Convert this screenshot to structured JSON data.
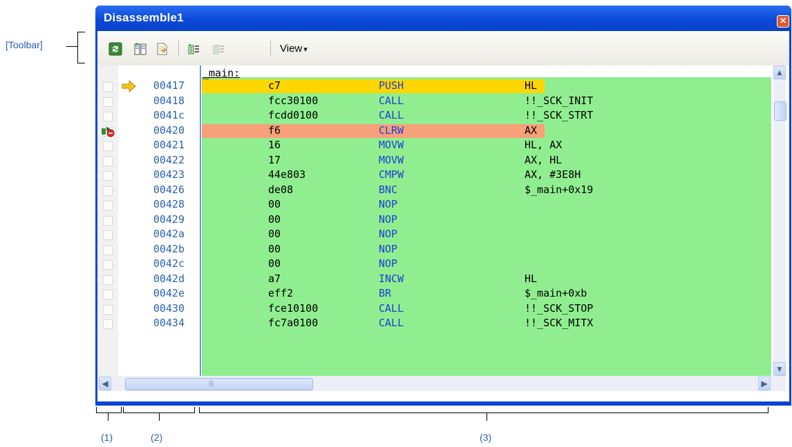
{
  "window": {
    "title": "Disassemble1",
    "close_glyph": "✕"
  },
  "toolbar": {
    "icons": [
      "refresh-icon",
      "show-code-icon",
      "jump-to-source-icon",
      "previous-symbol-icon",
      "next-symbol-icon"
    ],
    "view_label": "View",
    "view_arrow": "▾"
  },
  "annotations": {
    "toolbar": "[Toolbar]",
    "area1": "(1)",
    "area2": "(2)",
    "area3": "(3)"
  },
  "listing": {
    "label": "_main:",
    "rows": [
      {
        "addr": "00417",
        "code": "c7",
        "mnemonic": "PUSH",
        "operand": "HL",
        "marker": "current-pc-arrow",
        "highlight": "#ffd700"
      },
      {
        "addr": "00418",
        "code": "fcc30100",
        "mnemonic": "CALL",
        "operand": "!!_SCK_INIT"
      },
      {
        "addr": "0041c",
        "code": "fcdd0100",
        "mnemonic": "CALL",
        "operand": "!!_SCK_STRT"
      },
      {
        "addr": "00420",
        "code": "f6",
        "mnemonic": "CLRW",
        "operand": "AX",
        "marker": "breakpoint-icon",
        "highlight": "#f7a07a"
      },
      {
        "addr": "00421",
        "code": "16",
        "mnemonic": "MOVW",
        "operand": "HL, AX"
      },
      {
        "addr": "00422",
        "code": "17",
        "mnemonic": "MOVW",
        "operand": "AX, HL"
      },
      {
        "addr": "00423",
        "code": "44e803",
        "mnemonic": "CMPW",
        "operand": "AX, #3E8H"
      },
      {
        "addr": "00426",
        "code": "de08",
        "mnemonic": "BNC",
        "operand": "$_main+0x19"
      },
      {
        "addr": "00428",
        "code": "00",
        "mnemonic": "NOP",
        "operand": ""
      },
      {
        "addr": "00429",
        "code": "00",
        "mnemonic": "NOP",
        "operand": ""
      },
      {
        "addr": "0042a",
        "code": "00",
        "mnemonic": "NOP",
        "operand": ""
      },
      {
        "addr": "0042b",
        "code": "00",
        "mnemonic": "NOP",
        "operand": ""
      },
      {
        "addr": "0042c",
        "code": "00",
        "mnemonic": "NOP",
        "operand": ""
      },
      {
        "addr": "0042d",
        "code": "a7",
        "mnemonic": "INCW",
        "operand": "HL"
      },
      {
        "addr": "0042e",
        "code": "eff2",
        "mnemonic": "BR",
        "operand": "$_main+0xb"
      },
      {
        "addr": "00430",
        "code": "fce10100",
        "mnemonic": "CALL",
        "operand": "!!_SCK_STOP"
      },
      {
        "addr": "00434",
        "code": "fc7a0100",
        "mnemonic": "CALL",
        "operand": "!!_SCK_MITX"
      }
    ]
  },
  "colors": {
    "code_background": "#90ee90",
    "current_line": "#ffd700",
    "breakpoint_line": "#f7a07a",
    "address": "#2a62b5",
    "mnemonic": "#1a3fd8",
    "annotation": "#2a5db0",
    "window_frame": "#0a45d6"
  },
  "scrollbars": {
    "up": "▲",
    "down": "▼",
    "left": "◀",
    "right": "▶",
    "grip": "|||"
  }
}
